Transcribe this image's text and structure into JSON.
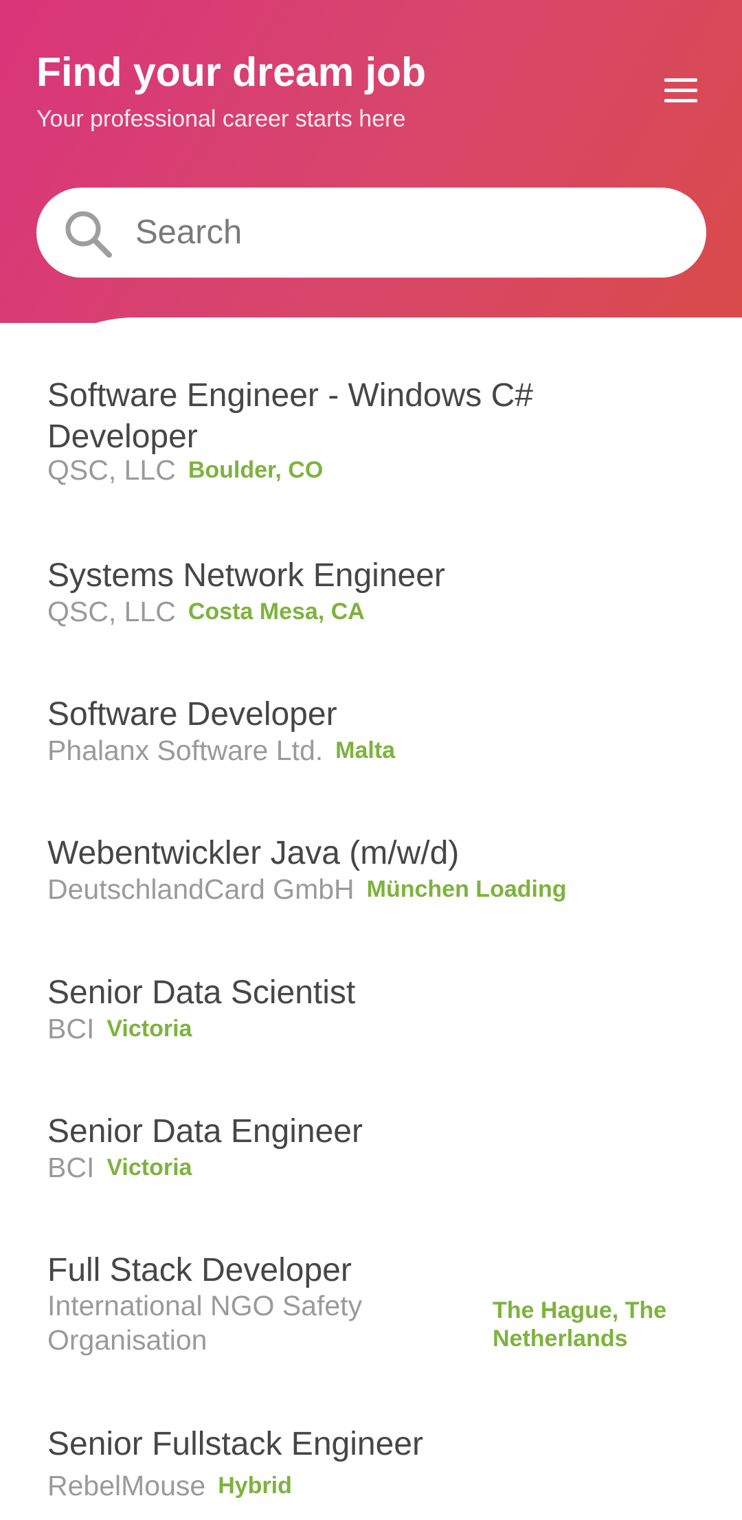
{
  "header": {
    "title": "Find your dream job",
    "subtitle": "Your professional career starts here",
    "menu_icon": "hamburger-menu-icon",
    "gradient_start": "#d9357a",
    "gradient_end": "#d94a4a"
  },
  "search": {
    "placeholder": "Search",
    "icon": "search-icon",
    "value": ""
  },
  "jobs": [
    {
      "title": "Software Engineer - Windows C# Developer",
      "company": "QSC, LLC",
      "location": "Boulder, CO"
    },
    {
      "title": "Systems Network Engineer",
      "company": "QSC, LLC",
      "location": "Costa Mesa, CA"
    },
    {
      "title": "Software Developer",
      "company": "Phalanx Software Ltd.",
      "location": "Malta"
    },
    {
      "title": "Webentwickler Java (m/w/d)",
      "company": "DeutschlandCard GmbH",
      "location": "München Loading"
    },
    {
      "title": "Senior Data Scientist",
      "company": "BCI",
      "location": "Victoria"
    },
    {
      "title": "Senior Data Engineer",
      "company": "BCI",
      "location": "Victoria"
    },
    {
      "title": "Full Stack Developer",
      "company": "International NGO Safety Organisation",
      "location": "The Hague, The Netherlands"
    },
    {
      "title": "Senior Fullstack Engineer",
      "company": "RebelMouse",
      "location": "Hybrid"
    }
  ],
  "colors": {
    "title_text": "#464646",
    "company_text": "#9a9a9a",
    "location_text": "#7db33d"
  }
}
